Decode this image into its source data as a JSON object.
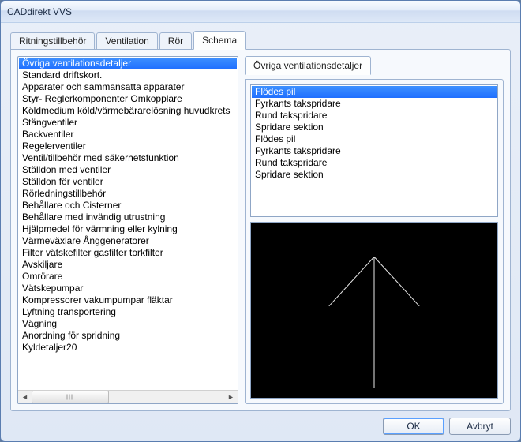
{
  "window": {
    "title": "CADdirekt VVS"
  },
  "tabs": {
    "items": [
      {
        "label": "Ritningstillbehör"
      },
      {
        "label": "Ventilation"
      },
      {
        "label": "Rör"
      },
      {
        "label": "Schema"
      }
    ],
    "active_index": 3
  },
  "category_list": {
    "selected_index": 0,
    "items": [
      "Övriga ventilationsdetaljer",
      "Standard driftskort.",
      "Apparater och sammansatta apparater",
      "Styr- Reglerkomponenter Omkopplare",
      "Köldmedium  köld/värmebärarelösning huvudkrets",
      "Stängventiler",
      "Backventiler",
      "Regelerventiler",
      "Ventil/tillbehör med säkerhetsfunktion",
      "Ställdon med ventiler",
      "Ställdon för ventiler",
      "Rörledningstillbehör",
      "Behållare och Cisterner",
      "Behållare med invändig utrustning",
      "Hjälpmedel för värmning eller kylning",
      "Värmeväxlare Ånggeneratorer",
      "Filter vätskefilter gasfilter torkfilter",
      "Avskiljare",
      "Omrörare",
      "Vätskepumpar",
      "Kompressorer vakumpumpar fläktar",
      "Lyftning transportering",
      "Vägning",
      "Anordning för spridning",
      "Kyldetaljer20"
    ]
  },
  "detail_tab": {
    "label": "Övriga ventilationsdetaljer"
  },
  "detail_list": {
    "selected_index": 0,
    "items": [
      "Flödes pil",
      "Fyrkants takspridare",
      "Rund takspridare",
      "Spridare sektion",
      "Flödes pil",
      "Fyrkants takspridare",
      "Rund takspridare",
      "Spridare sektion"
    ]
  },
  "buttons": {
    "ok": "OK",
    "cancel": "Avbryt"
  }
}
